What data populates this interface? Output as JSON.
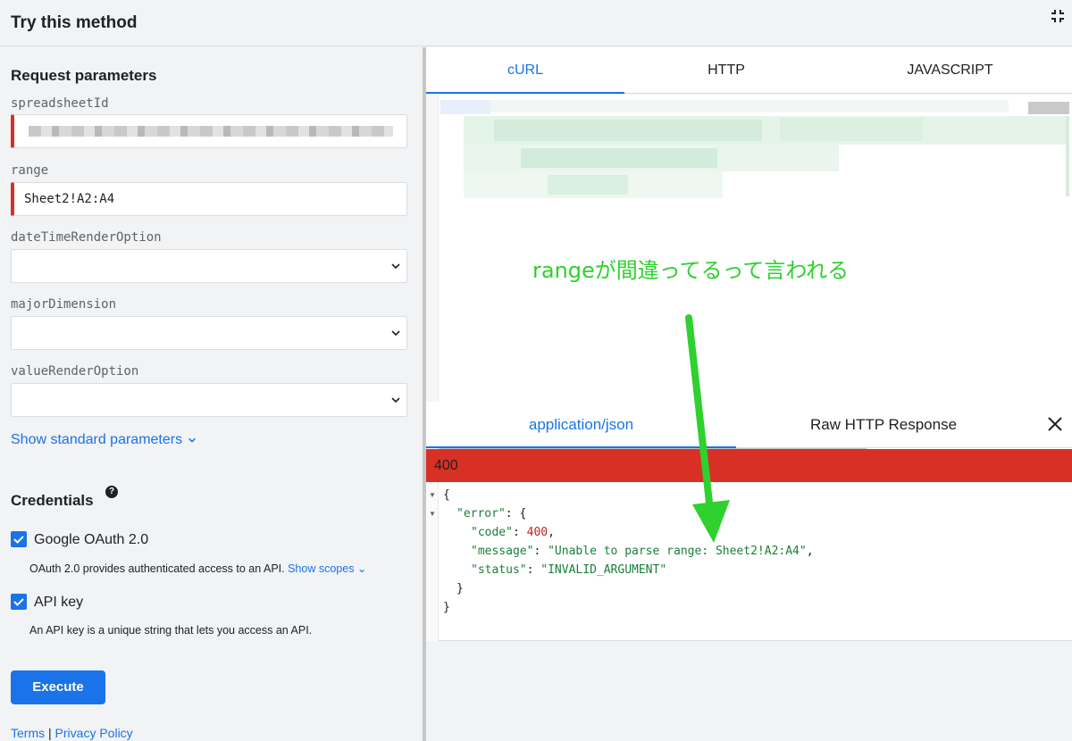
{
  "header": {
    "title": "Try this method"
  },
  "request": {
    "title": "Request parameters",
    "params": [
      {
        "name": "spreadsheetId",
        "value": ""
      },
      {
        "name": "range",
        "value": "Sheet2!A2:A4"
      },
      {
        "name": "dateTimeRenderOption",
        "value": ""
      },
      {
        "name": "majorDimension",
        "value": ""
      },
      {
        "name": "valueRenderOption",
        "value": ""
      }
    ],
    "show_standard": "Show standard parameters"
  },
  "credentials": {
    "title": "Credentials",
    "help": "?",
    "oauth": {
      "label": "Google OAuth 2.0",
      "checked": true,
      "desc": "OAuth 2.0 provides authenticated access to an API.",
      "show_scopes": "Show scopes"
    },
    "apikey": {
      "label": "API key",
      "checked": true,
      "desc": "An API key is a unique string that lets you access an API."
    }
  },
  "execute_label": "Execute",
  "footer": {
    "terms": "Terms",
    "sep": "|",
    "privacy": "Privacy Policy"
  },
  "code_tabs": [
    "cURL",
    "HTTP",
    "JAVASCRIPT"
  ],
  "annotation": "rangeが間違ってるって言われる",
  "response": {
    "tabs": [
      "application/json",
      "Raw HTTP Response"
    ],
    "status": "400",
    "json": {
      "open": "{",
      "error_key": "\"error\"",
      "error_open": ": {",
      "code_key": "\"code\"",
      "code_val": "400",
      "message_key": "\"message\"",
      "message_val": "\"Unable to parse range: Sheet2!A2:A4\"",
      "status_key": "\"status\"",
      "status_val": "\"INVALID_ARGUMENT\"",
      "inner_close": "}",
      "close": "}"
    }
  },
  "colors": {
    "accent": "#1a73e8",
    "error": "#d93025",
    "annotation": "#2ed12e"
  }
}
